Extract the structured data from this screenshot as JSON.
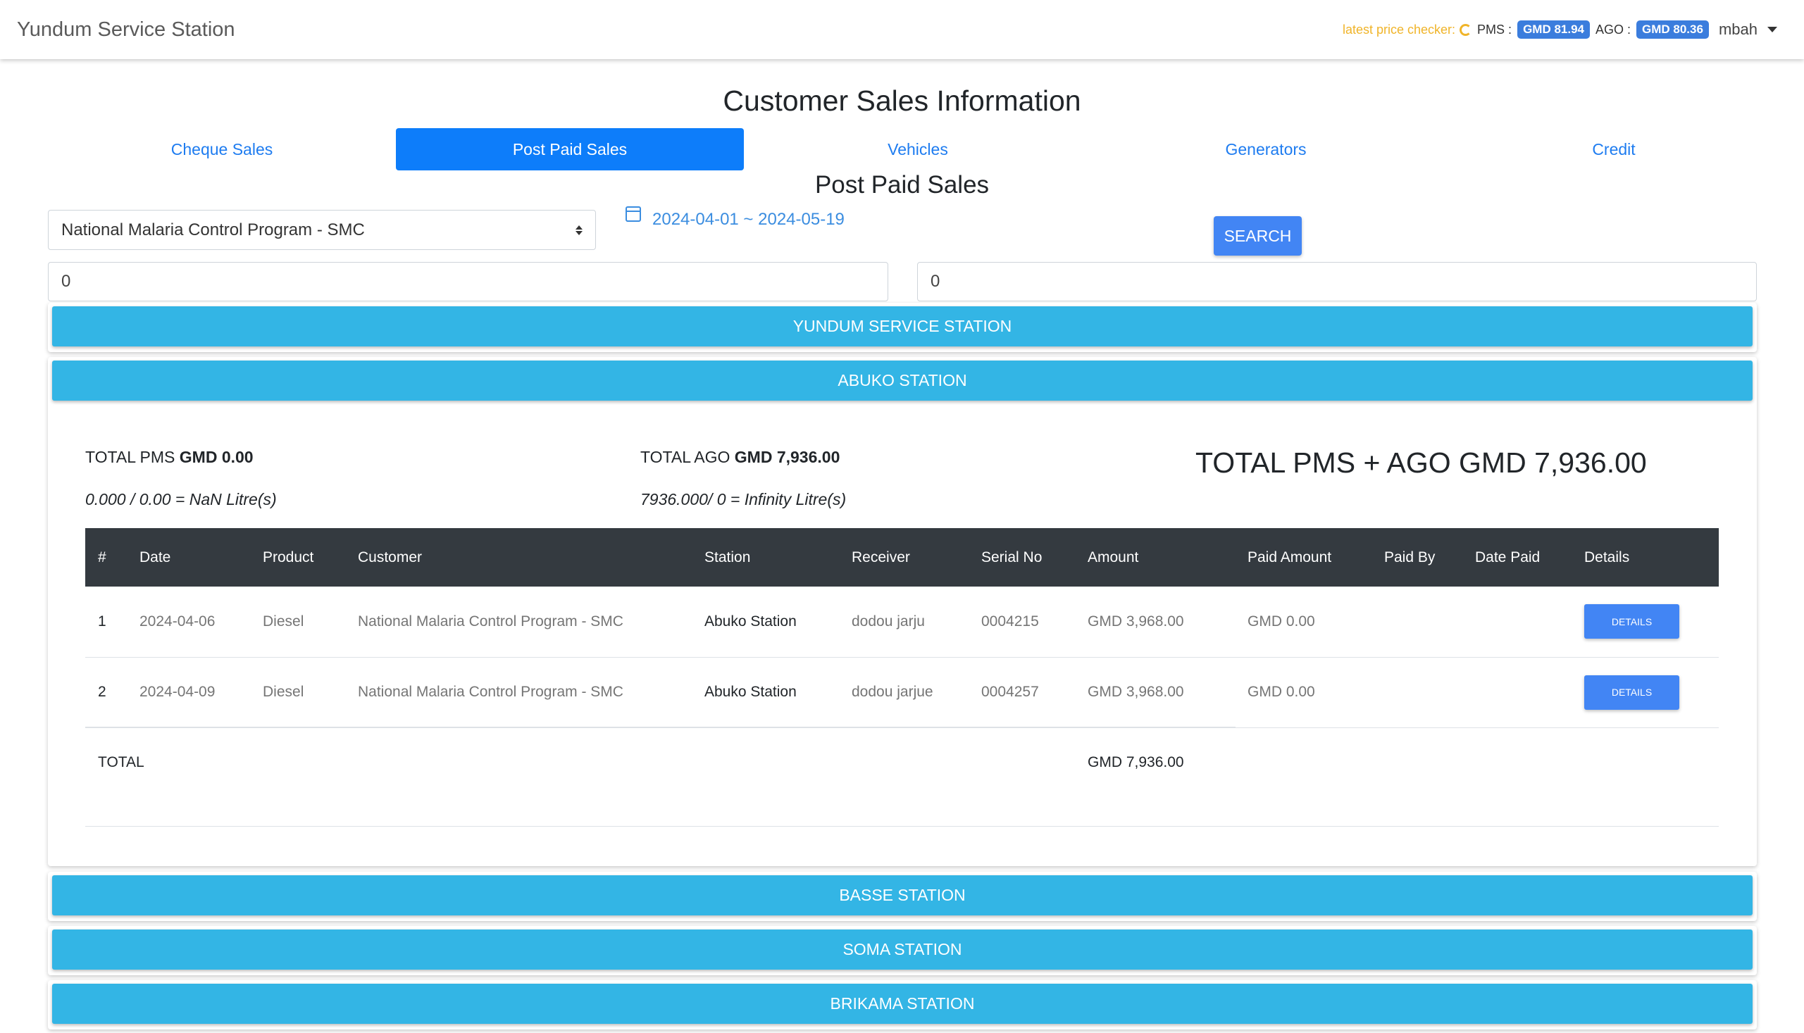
{
  "header": {
    "brand": "Yundum Service Station",
    "price_label": "latest price checker:",
    "pms_label": "PMS :",
    "pms_price": "GMD 81.94",
    "ago_label": "AGO :",
    "ago_price": "GMD 80.36",
    "user": "mbah"
  },
  "page_title": "Customer Sales Information",
  "tabs": [
    {
      "label": "Cheque Sales",
      "active": false
    },
    {
      "label": "Post Paid Sales",
      "active": true
    },
    {
      "label": "Vehicles",
      "active": false
    },
    {
      "label": "Generators",
      "active": false
    },
    {
      "label": "Credit",
      "active": false
    }
  ],
  "section_title": "Post Paid Sales",
  "filters": {
    "customer_selected": "National Malaria Control Program - SMC",
    "date_range": "2024-04-01 ~ 2024-05-19",
    "search_label": "SEARCH",
    "input_left": "0",
    "input_right": "0"
  },
  "stations": [
    {
      "name": "YUNDUM SERVICE STATION"
    },
    {
      "name": "ABUKO STATION"
    },
    {
      "name": "BASSE STATION"
    },
    {
      "name": "SOMA STATION"
    },
    {
      "name": "BRIKAMA STATION"
    }
  ],
  "summary": {
    "pms_label": "TOTAL PMS",
    "pms_value": "GMD 0.00",
    "pms_calc": "0.000 / 0.00 = NaN Litre(s)",
    "ago_label": "TOTAL AGO",
    "ago_value": "GMD 7,936.00",
    "ago_calc": "7936.000/ 0 = Infinity Litre(s)",
    "grand_total": "TOTAL PMS + AGO GMD 7,936.00"
  },
  "table": {
    "headers": [
      "#",
      "Date",
      "Product",
      "Customer",
      "Station",
      "Receiver",
      "Serial No",
      "Amount",
      "Paid Amount",
      "Paid By",
      "Date Paid",
      "Details"
    ],
    "rows": [
      {
        "num": "1",
        "date": "2024-04-06",
        "product": "Diesel",
        "customer": "National Malaria Control Program - SMC",
        "station": "Abuko Station",
        "receiver": "dodou jarju",
        "serial": "0004215",
        "amount": "GMD 3,968.00",
        "paid_amount": "GMD 0.00",
        "paid_by": "",
        "date_paid": "",
        "details_label": "DETAILS"
      },
      {
        "num": "2",
        "date": "2024-04-09",
        "product": "Diesel",
        "customer": "National Malaria Control Program - SMC",
        "station": "Abuko Station",
        "receiver": "dodou jarjue",
        "serial": "0004257",
        "amount": "GMD 3,968.00",
        "paid_amount": "GMD 0.00",
        "paid_by": "",
        "date_paid": "",
        "details_label": "DETAILS"
      }
    ],
    "total_label": "TOTAL",
    "total_amount": "GMD 7,936.00"
  }
}
